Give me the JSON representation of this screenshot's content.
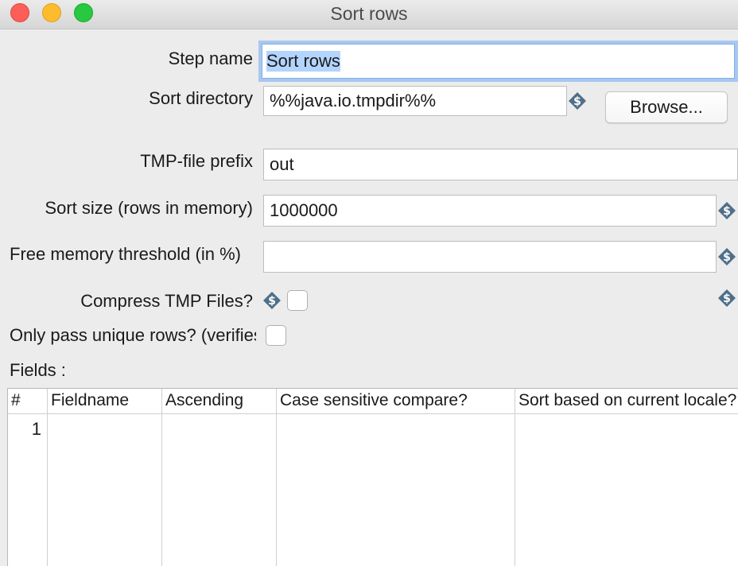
{
  "window": {
    "title": "Sort rows"
  },
  "form": {
    "step_name_label": "Step name",
    "step_name_value": "Sort rows",
    "sort_directory_label": "Sort directory",
    "sort_directory_value": "%%java.io.tmpdir%%",
    "browse_label": "Browse...",
    "tmp_prefix_label": "TMP-file prefix",
    "tmp_prefix_value": "out",
    "sort_size_label": "Sort size (rows in memory)",
    "sort_size_value": "1000000",
    "free_memory_label": "Free memory threshold (in %)",
    "free_memory_value": "",
    "compress_label": "Compress TMP Files?",
    "compress_checked": false,
    "unique_label": "Only pass unique rows? (verifies keys only)",
    "unique_checked": false,
    "fields_label": "Fields :"
  },
  "table": {
    "columns": [
      "#",
      "Fieldname",
      "Ascending",
      "Case sensitive compare?",
      "Sort based on current locale?"
    ],
    "rows": [
      {
        "num": "1",
        "fieldname": "",
        "ascending": "",
        "case_sensitive": "",
        "locale": ""
      }
    ]
  },
  "icons": {
    "variable_icon": "dollar-diamond-icon"
  },
  "colors": {
    "focus_ring": "#a8c8f0",
    "selection": "#b3d4fc",
    "variable_icon": "#4f6f8a"
  }
}
